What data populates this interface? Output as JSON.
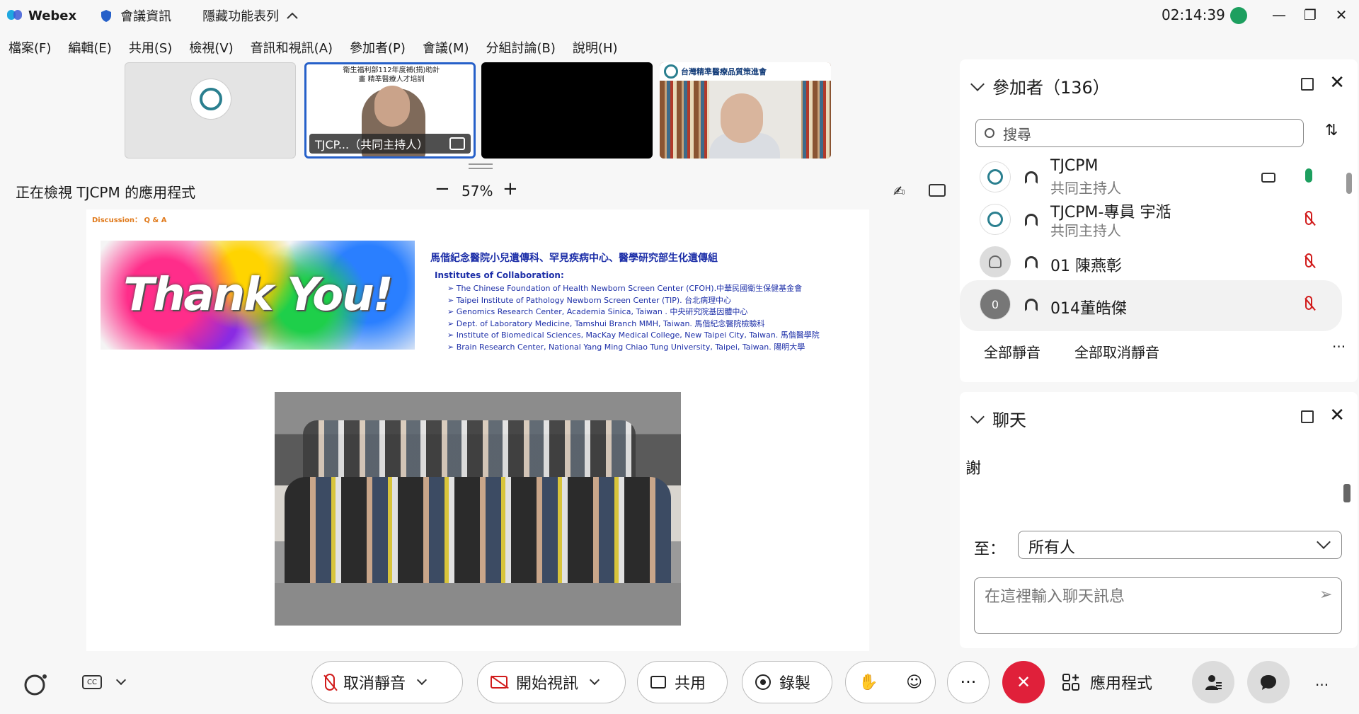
{
  "titlebar": {
    "app_name": "Webex",
    "meeting_info": "會議資訊",
    "hidden_menu": "隱藏功能表列",
    "clock": "02:14:39",
    "minimize": "—",
    "restore": "❐",
    "close": "✕"
  },
  "menubar": {
    "items": [
      "檔案(F)",
      "編輯(E)",
      "共用(S)",
      "檢視(V)",
      "音訊和視訊(A)",
      "參加者(P)",
      "會議(M)",
      "分組討論(B)",
      "說明(H)"
    ]
  },
  "thumbnails": {
    "t2_name": "TJCP...（共同主持人）",
    "t2_slide_heading": "衛生福利部112年度補(捐)助計畫 精準醫療人才培訓",
    "t4_banner": "台灣精準醫療品質策進會"
  },
  "viewbar": {
    "viewing_label": "正在檢視 TJCPM 的應用程式",
    "zoom_minus": "−",
    "zoom_level": "57%",
    "zoom_plus": "+",
    "annotate": "✍"
  },
  "slide": {
    "discussion": "Discussion： Q & A",
    "thanks": "Thank You!",
    "hospital_title": "馬偕紀念醫院小兒遺傳科、罕見疾病中心、醫學研究部生化遺傳組",
    "institutes_label": "Institutes of Collaboration:",
    "institutes": [
      "The Chinese Foundation of Health Newborn Screen Center (CFOH).中華民國衛生保健基金會",
      "Taipei Institute of Pathology Newborn Screen Center (TIP). 台北病理中心",
      "Genomics Research Center, Academia Sinica, Taiwan . 中央研究院基因體中心",
      "Dept. of Laboratory Medicine, Tamshui Branch MMH, Taiwan. 馬偕紀念醫院檢驗科",
      "Institute of Biomedical Sciences, MacKay Medical College, New Taipei City, Taiwan. 馬偕醫學院",
      "Brain Research Center, National Yang Ming Chiao Tung University, Taipei, Taiwan. 陽明大學"
    ]
  },
  "participants": {
    "title": "參加者",
    "count": "（136）",
    "search_placeholder": "搜尋",
    "sort": "⇅",
    "list": [
      {
        "name": "TJCPM",
        "role": "共同主持人"
      },
      {
        "name": "TJCPM-專員 宇湉",
        "role": "共同主持人"
      },
      {
        "name": "01 陳燕彰",
        "role": ""
      },
      {
        "name": "014董皓傑",
        "role": "",
        "initial": "0"
      }
    ],
    "mute_all": "全部靜音",
    "unmute_all": "全部取消靜音",
    "more": "···"
  },
  "chat": {
    "title": "聊天",
    "message": "謝",
    "to_label": "至：",
    "to_value": "所有人",
    "input_placeholder": "在這裡輸入聊天訊息",
    "send": "➢"
  },
  "toolbar": {
    "unmute": "取消靜音",
    "start_video": "開始視訊",
    "share": "共用",
    "record": "錄製",
    "reactions": "☺",
    "more": "···",
    "end": "✕",
    "apps": "應用程式",
    "extra_more": "···"
  },
  "colors": {
    "accent_blue": "#2660c9",
    "mute_red": "#d11b1b",
    "end_red": "#e0203a",
    "live_green": "#1d9f5f",
    "slide_text_blue": "#1d2fa8"
  }
}
